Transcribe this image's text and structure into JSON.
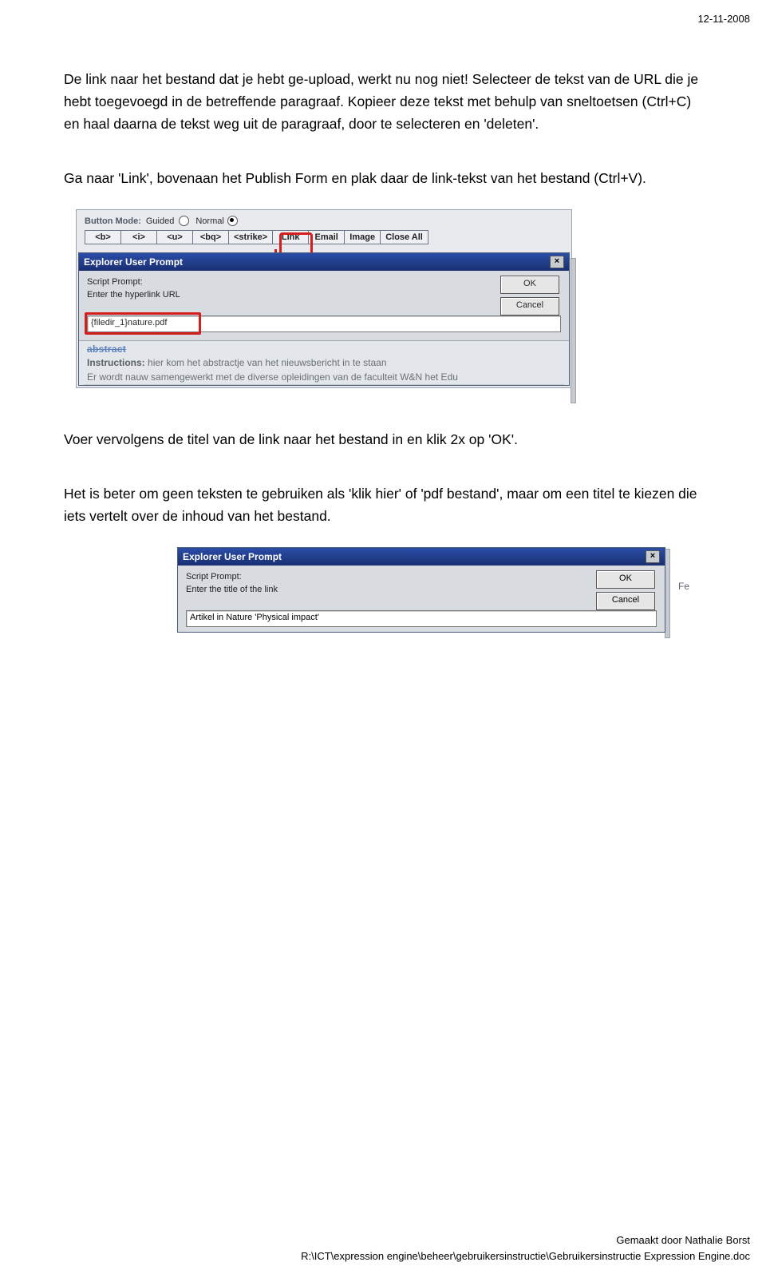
{
  "header": {
    "date": "12-11-2008"
  },
  "para1": "De link naar het bestand dat je hebt ge-upload, werkt nu nog niet! Selecteer de tekst van de URL die je hebt toegevoegd in de betreffende paragraaf. Kopieer deze tekst met behulp van sneltoetsen (Ctrl+C) en haal daarna de tekst weg uit de paragraaf, door te selecteren en 'deleten'.",
  "para2": "Ga naar 'Link', bovenaan het Publish Form en plak daar de link-tekst van het bestand (Ctrl+V).",
  "para3": "Voer vervolgens de titel van de link naar het bestand in en klik 2x op 'OK'.",
  "para4": "Het is beter om geen teksten te gebruiken als 'klik hier' of 'pdf bestand', maar om een titel te kiezen die iets vertelt over de inhoud van het bestand.",
  "shot1": {
    "mode_label": "Button Mode:",
    "mode_guided": "Guided",
    "mode_normal": "Normal",
    "toolbar": [
      "<b>",
      "<i>",
      "<u>",
      "<bq>",
      "<strike>",
      "Link",
      "Email",
      "Image",
      "Close All"
    ],
    "dlg": {
      "title": "Explorer User Prompt",
      "close": "×",
      "script_prompt": "Script Prompt:",
      "prompt": "Enter the hyperlink URL",
      "ok": "OK",
      "cancel": "Cancel",
      "value": "{filedir_1}nature.pdf"
    },
    "under": {
      "struck": "abstract",
      "instr_label": "Instructions:",
      "instr_text": "hier kom het abstractje van het nieuwsbericht in te staan",
      "cut": "Er wordt nauw samengewerkt met de diverse opleidingen van de faculteit W&N  het Edu"
    }
  },
  "shot2": {
    "title": "Explorer User Prompt",
    "close": "×",
    "script_prompt": "Script Prompt:",
    "prompt": "Enter the title of the link",
    "ok": "OK",
    "cancel": "Cancel",
    "value": "Artikel in Nature 'Physical impact'",
    "fe": "Fe"
  },
  "footer": {
    "by": "Gemaakt door Nathalie Borst",
    "path": "R:\\ICT\\expression engine\\beheer\\gebruikersinstructie\\Gebruikersinstructie Expression Engine.doc"
  }
}
